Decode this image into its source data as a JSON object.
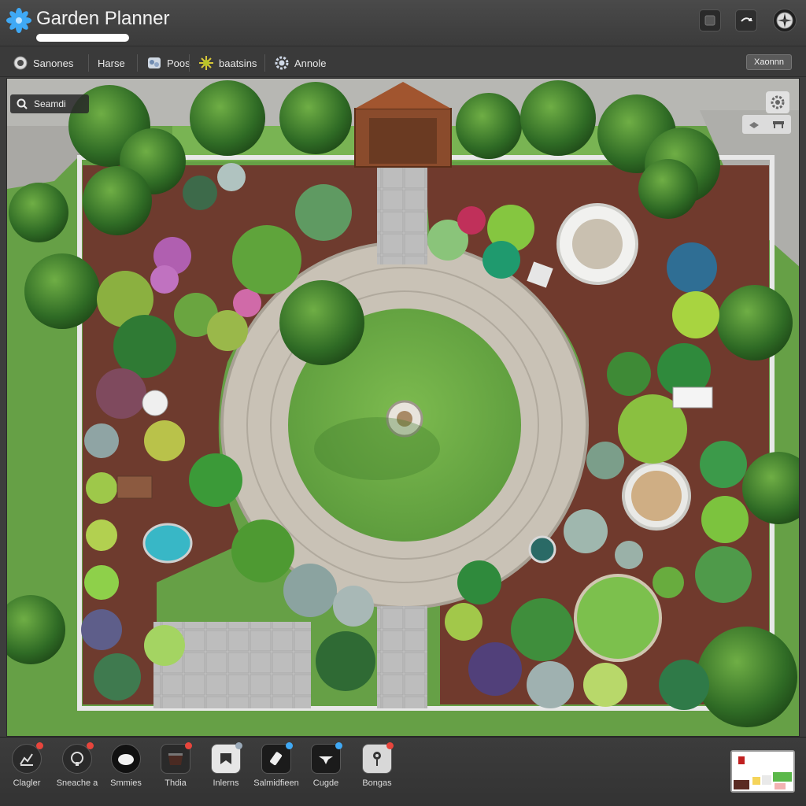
{
  "app": {
    "title": "Garden Planner",
    "logo_icon": "flower-logo-icon",
    "accent": "#3fa9f5"
  },
  "titlebar": {
    "buttons": [
      {
        "icon": "square-icon"
      },
      {
        "icon": "undo-arrow-icon"
      },
      {
        "icon": "compass-icon"
      }
    ]
  },
  "toolbar": {
    "items": [
      {
        "label": "Sanones",
        "icon": "leaf-circle-icon"
      },
      {
        "label": "Harse",
        "icon": ""
      },
      {
        "label": "Poos",
        "icon": "stones-icon"
      },
      {
        "label": "baatsins",
        "icon": "sun-flower-icon"
      },
      {
        "label": "Annole",
        "icon": "gear-icon"
      }
    ],
    "right_button": "Xaonnn"
  },
  "canvas": {
    "search_label": "Seamdi",
    "search_icon": "search-icon",
    "view_tools": [
      "gear-icon",
      "cube-icon",
      "bench-icon"
    ]
  },
  "tray": {
    "items": [
      {
        "label": "Clagler",
        "icon": "plant-chart-icon",
        "dot": "#e8453c"
      },
      {
        "label": "Sneache a",
        "icon": "shrub-icon",
        "dot": "#e8453c"
      },
      {
        "label": "Smmies",
        "icon": "boulder-icon",
        "dot": ""
      },
      {
        "label": "Thdia",
        "icon": "bed-icon",
        "dot": "#e8453c"
      },
      {
        "label": "Inlerns",
        "icon": "flag-icon",
        "dot": "#9aa9b8"
      },
      {
        "label": "Salmidfieen",
        "icon": "tag-icon",
        "dot": "#3fa9f5"
      },
      {
        "label": "Cugde",
        "icon": "sparkle-icon",
        "dot": "#3fa9f5"
      },
      {
        "label": "Bongas",
        "icon": "sapling-icon",
        "dot": "#e8453c"
      }
    ]
  },
  "colors": {
    "lawn": "#6ea84a",
    "path_stone": "#c9c2b6",
    "mulch": "#6b3a2e",
    "pavement": "#b9b9b9"
  }
}
